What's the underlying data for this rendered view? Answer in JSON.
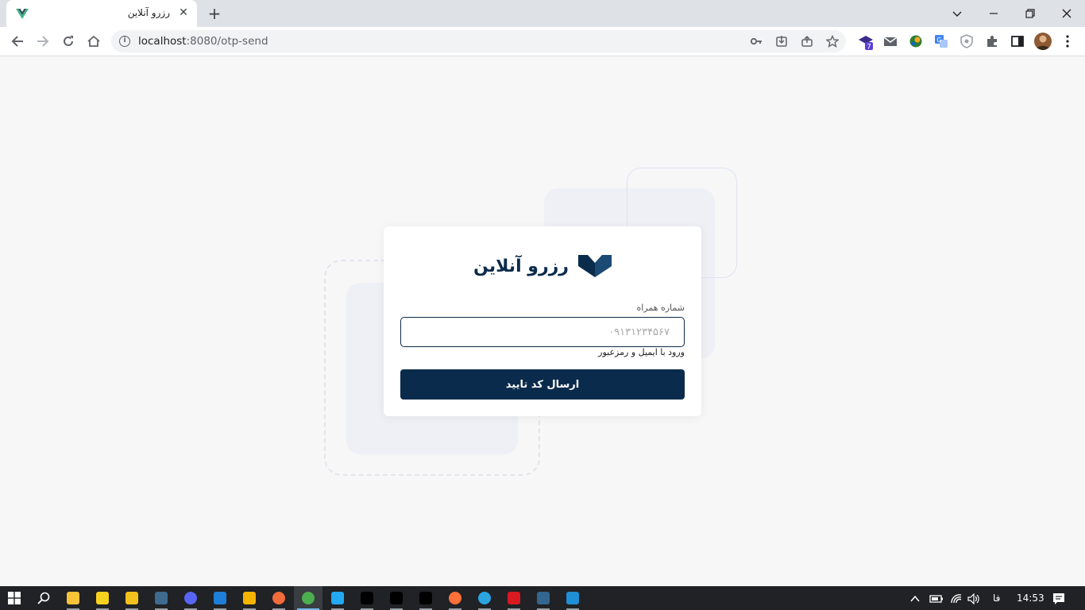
{
  "browser": {
    "tab": {
      "title": "رزرو آنلاین",
      "close_label": "✕"
    },
    "new_tab_label": "+",
    "window_controls": {
      "list": "⌄",
      "minimize": "—",
      "restore": "❐",
      "close": "✕"
    },
    "address": {
      "host": "localhost",
      "rest": ":8080/otp-send"
    },
    "extensions_badge": "7"
  },
  "page": {
    "brand_name": "رزرو آنلاین",
    "phone_label": "شماره همراه",
    "phone_placeholder": "۰۹۱۳۱۲۳۴۵۶۷",
    "phone_value": "",
    "email_login_link": "ورود با ایمیل و رمزعبور",
    "submit_label": "ارسال کد تایید"
  },
  "colors": {
    "primary": "#0b2b4c",
    "page_bg": "#f7f7f8",
    "deco_fill": "#eef0f6",
    "deco_border": "#dfe3f0"
  },
  "taskbar": {
    "apps": [
      "file-explorer",
      "sticky-notes",
      "media-player",
      "mysql-workbench",
      "discord",
      "trello",
      "app-triangle",
      "app-orange",
      "chrome",
      "vscode",
      "phpstorm",
      "pycharm",
      "webstorm",
      "firefox",
      "telegram",
      "app-red",
      "postgresql",
      "photos"
    ],
    "language": "فا",
    "time": "14:53"
  }
}
